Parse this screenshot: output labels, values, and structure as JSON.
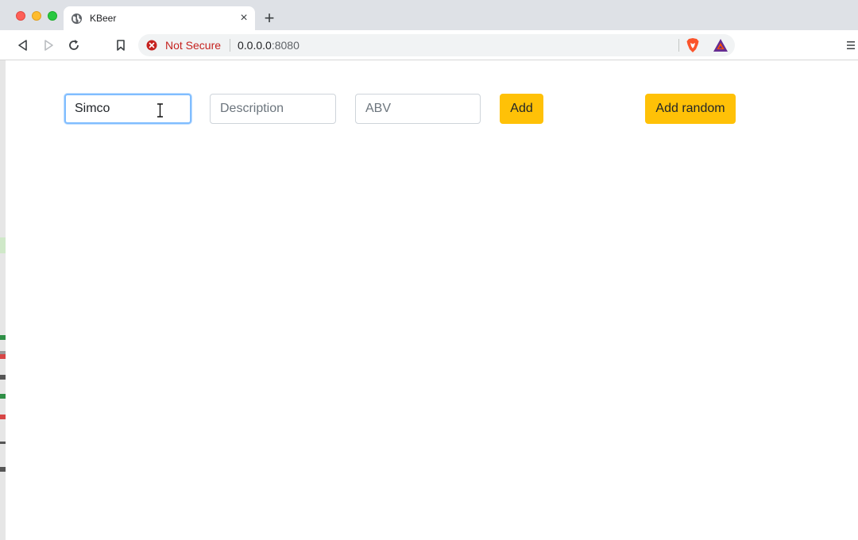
{
  "browser": {
    "tab_title": "KBeer",
    "tab_close_glyph": "×",
    "new_tab_glyph": "+",
    "security_label": "Not Secure",
    "url_host": "0.0.0.0",
    "url_port": ":8080",
    "icons": [
      "globe-icon",
      "back-icon",
      "forward-icon",
      "reload-icon",
      "bookmark-icon",
      "not-secure-icon",
      "brave-shields-icon",
      "brave-rewards-icon",
      "menu-icon"
    ],
    "colors": {
      "security_warning": "#c5221f",
      "tab_strip": "#dee1e6"
    }
  },
  "form": {
    "name_value": "Simco",
    "name_placeholder": "",
    "description_value": "",
    "description_placeholder": "Description",
    "abv_value": "",
    "abv_placeholder": "ABV",
    "add_label": "Add",
    "add_random_label": "Add random",
    "accent_color": "#ffc107",
    "focus_color": "#80bdff"
  }
}
